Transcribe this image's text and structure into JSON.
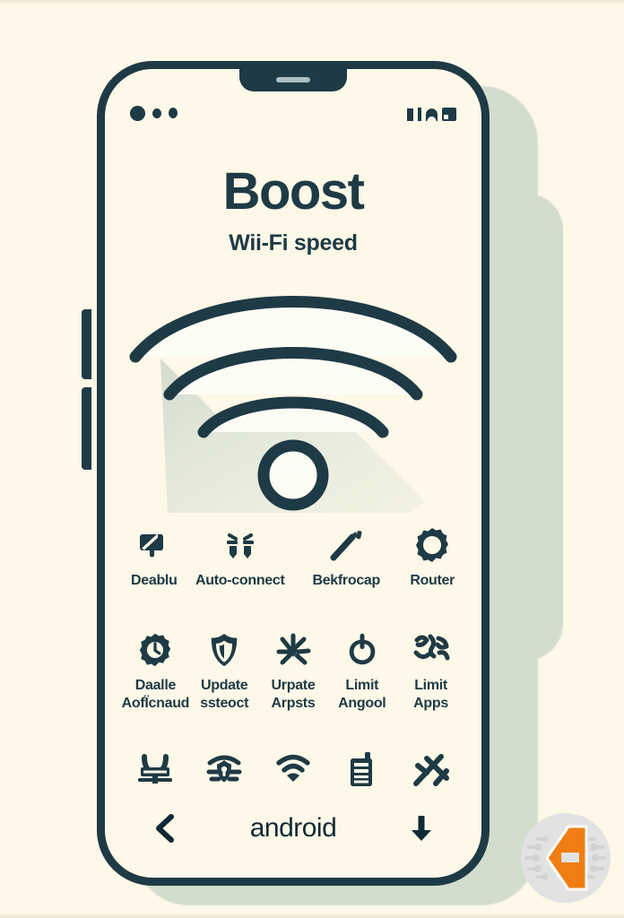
{
  "screen": {
    "background_color": "#FDF8E7",
    "ink_color": "#1E3A45",
    "shadow_color": "#D3DDCE"
  },
  "statusbar": {
    "camera_dots": [
      "camera-lens-dot",
      "sensor-dot-small",
      "sensor-dot-small"
    ],
    "right_glyphs": [
      "signal-bar-glyph",
      "signal-stem-glyph",
      "arch-glyph",
      "battery-box-glyph"
    ]
  },
  "header": {
    "title": "Boost",
    "subtitle": "Wii-Fi speed"
  },
  "hero": {
    "icon": "wifi-signal-icon",
    "arcs": 3,
    "has_center_dot": true,
    "has_drop_shadow": true
  },
  "rows": [
    {
      "id": "row-1",
      "tiles": [
        {
          "icon": "thumbs-down-slashed-icon",
          "label": "Deablu",
          "wide": false
        },
        {
          "icon": "plug-connector-icon",
          "label": "Auto-connect",
          "wide": true
        },
        {
          "icon": "magic-wand-icon",
          "label": "Bekfrocap",
          "wide": true
        },
        {
          "icon": "gear-icon",
          "label": "Router",
          "wide": false
        }
      ]
    },
    {
      "id": "row-2",
      "tiles": [
        {
          "icon": "gear-refresh-icon",
          "label": "Daalle\nAofÏcnaud",
          "wide": false
        },
        {
          "icon": "shield-icon",
          "label": "Update\nssteoct",
          "wide": false
        },
        {
          "icon": "star-burst-icon",
          "label": "Urpate\nArpsts",
          "wide": false
        },
        {
          "icon": "power-button-icon",
          "label": "Limit\nAngool",
          "wide": false
        },
        {
          "icon": "scribble-chart-icon",
          "label": "Limit\nApps",
          "wide": false
        }
      ]
    },
    {
      "id": "row-3",
      "tiles": [
        {
          "icon": "router-antenna-icon",
          "label": "",
          "wide": false
        },
        {
          "icon": "wifi-shield-icon",
          "label": "",
          "wide": false
        },
        {
          "icon": "wifi-solid-icon",
          "label": "",
          "wide": false
        },
        {
          "icon": "server-device-icon",
          "label": "",
          "wide": false
        },
        {
          "icon": "diagonal-slash-arrow-icon",
          "label": "",
          "wide": false
        }
      ]
    }
  ],
  "bottombar": {
    "back_icon": "chevron-left-icon",
    "brand": "android",
    "download_icon": "arrow-down-icon"
  },
  "watermark": {
    "icon": "hexagon-e-circuit-logo",
    "accent_color": "#F07D12",
    "disc_color": "#E2E2E2"
  }
}
